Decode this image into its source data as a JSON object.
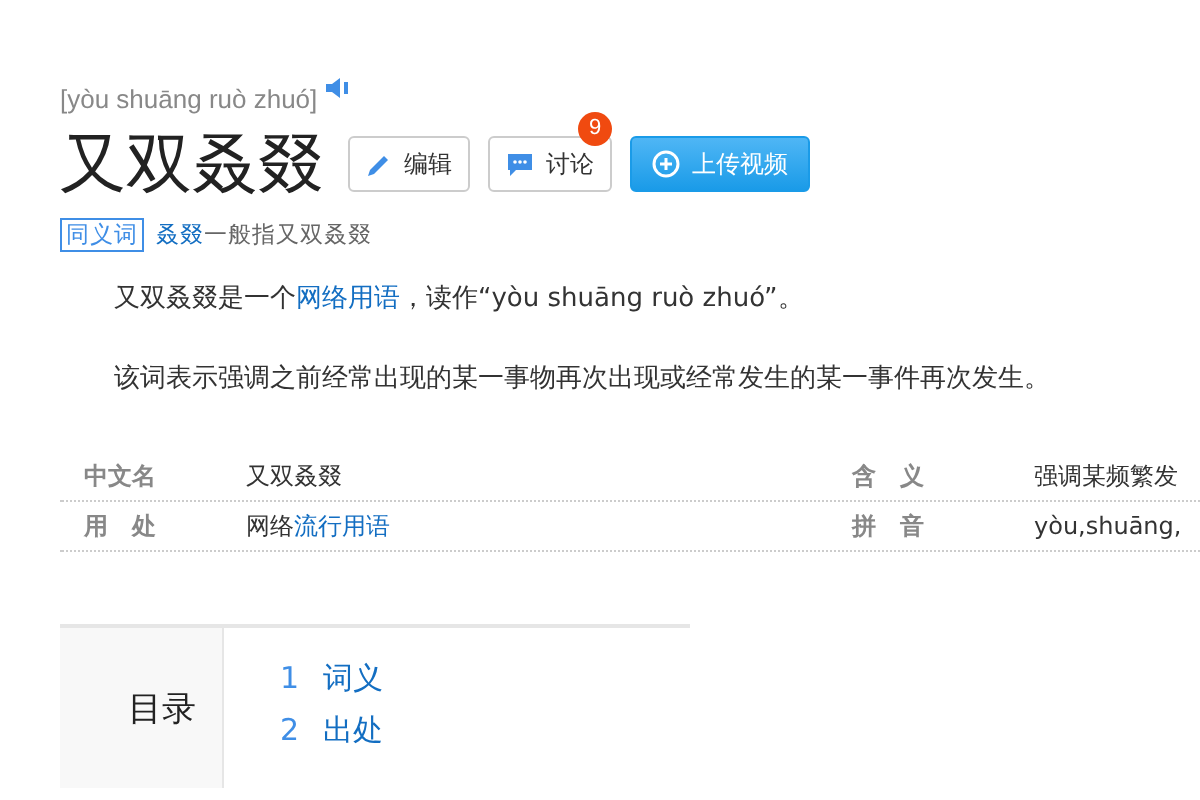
{
  "pinyin": "[yòu shuāng ruò zhuó]",
  "title": "又双叒叕",
  "buttons": [
    {
      "kind": "edit",
      "label": "编辑"
    },
    {
      "kind": "discuss",
      "label": "讨论",
      "badge": "9"
    },
    {
      "kind": "upload",
      "label": "上传视频"
    }
  ],
  "synonym": {
    "tag": "同义词",
    "link": "叒叕",
    "text": "一般指又双叒叕"
  },
  "paragraphs": [
    {
      "before": "又双叒叕是一个",
      "link": "网络用语",
      "after": "，读作“yòu shuāng ruò zhuó”。"
    },
    {
      "before": "该词表示强调之前经常出现的某一事物再次出现或经常发生的某一事件再次发生。"
    }
  ],
  "info_rows": [
    {
      "label": "中文名",
      "value": "又双叒叕",
      "label2": "含　义",
      "value2": "强调某频繁发"
    },
    {
      "label": "用　处",
      "value": "网络",
      "value_link": "流行用语",
      "label2": "拼　音",
      "value2": "yòu,shuāng,"
    }
  ],
  "toc": {
    "title": "目录",
    "items": [
      {
        "number": "1",
        "label": "词义"
      },
      {
        "number": "2",
        "label": "出处"
      }
    ]
  }
}
